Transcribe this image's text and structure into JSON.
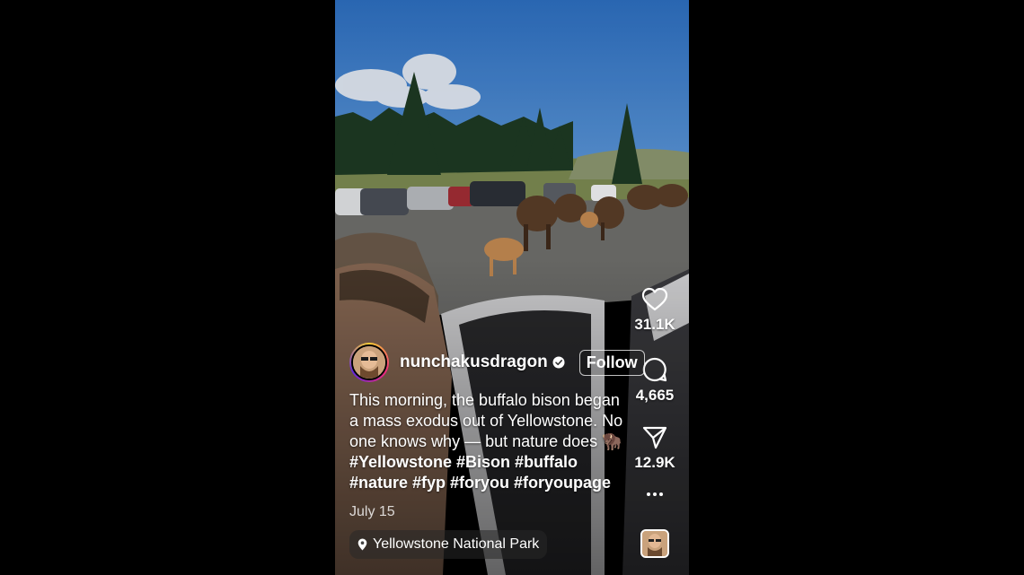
{
  "post": {
    "username": "nunchakusdragon",
    "follow_label": "Follow",
    "caption_text": "This morning, the buffalo bison began a mass exodus out of Yellowstone. No one knows why — but nature does 🦬",
    "caption_tags": "#Yellowstone #Bison #buffalo #nature #fyp #foryou #foryoupage",
    "date": "July 15",
    "location": "Yellowstone National Park"
  },
  "actions": {
    "likes": "31.1K",
    "comments": "4,665",
    "shares": "12.9K"
  },
  "icons": [
    "heart-icon",
    "comment-icon",
    "share-icon",
    "more-icon",
    "location-pin-icon",
    "verified-icon"
  ],
  "colors": {
    "background": "#000000",
    "text": "#ffffff"
  }
}
